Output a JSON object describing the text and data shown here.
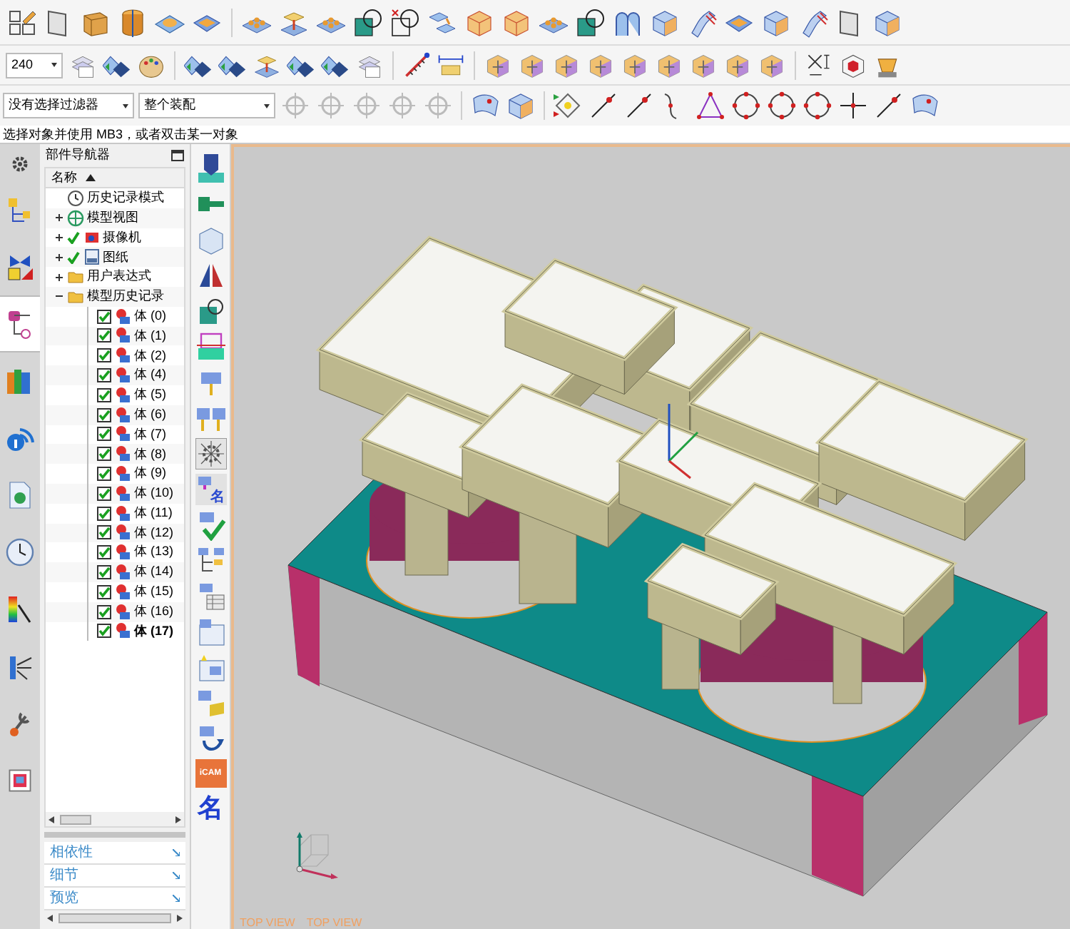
{
  "toolbar": {
    "scale_value": "240",
    "selection_filter": "没有选择过滤器",
    "assembly_scope": "整个装配"
  },
  "status_bar": {
    "prompt": "选择对象并使用 MB3，或者双击某一对象"
  },
  "resource_tabs": [
    {
      "selected": false
    },
    {
      "selected": false
    },
    {
      "selected": true
    },
    {
      "selected": false
    },
    {
      "selected": false
    },
    {
      "selected": false
    },
    {
      "selected": false
    },
    {
      "selected": false
    },
    {
      "selected": false
    },
    {
      "selected": false
    }
  ],
  "navigator": {
    "title": "部件导航器",
    "column": "名称",
    "items": [
      {
        "label": "历史记录模式",
        "kind": "history"
      },
      {
        "label": "模型视图",
        "kind": "views",
        "expanded": false
      },
      {
        "label": "摄像机",
        "kind": "camera",
        "expanded": false,
        "checked": true
      },
      {
        "label": "图纸",
        "kind": "drawing",
        "expanded": false,
        "checked": true
      },
      {
        "label": "用户表达式",
        "kind": "folder",
        "expanded": false
      },
      {
        "label": "模型历史记录",
        "kind": "folder",
        "expanded": true,
        "children": [
          {
            "label": "体 (0)",
            "checked": true,
            "current": false
          },
          {
            "label": "体 (1)",
            "checked": true,
            "current": false
          },
          {
            "label": "体 (2)",
            "checked": true,
            "current": false
          },
          {
            "label": "体 (4)",
            "checked": true,
            "current": false
          },
          {
            "label": "体 (5)",
            "checked": true,
            "current": false
          },
          {
            "label": "体 (6)",
            "checked": true,
            "current": false
          },
          {
            "label": "体 (7)",
            "checked": true,
            "current": false
          },
          {
            "label": "体 (8)",
            "checked": true,
            "current": false
          },
          {
            "label": "体 (9)",
            "checked": true,
            "current": false
          },
          {
            "label": "体 (10)",
            "checked": true,
            "current": false
          },
          {
            "label": "体 (11)",
            "checked": true,
            "current": false
          },
          {
            "label": "体 (12)",
            "checked": true,
            "current": false
          },
          {
            "label": "体 (13)",
            "checked": true,
            "current": false
          },
          {
            "label": "体 (14)",
            "checked": true,
            "current": false
          },
          {
            "label": "体 (15)",
            "checked": true,
            "current": false
          },
          {
            "label": "体 (16)",
            "checked": true,
            "current": false
          },
          {
            "label": "体 (17)",
            "checked": true,
            "current": true
          }
        ]
      }
    ],
    "panels": [
      "相依性",
      "细节",
      "预览"
    ]
  },
  "vertical_toolbar": {
    "name_tool_label": "名",
    "icam_label": "iCAM",
    "name_button_label": "名"
  },
  "viewport": {
    "view_labels": [
      "TOP VIEW",
      "TOP VIEW"
    ]
  }
}
